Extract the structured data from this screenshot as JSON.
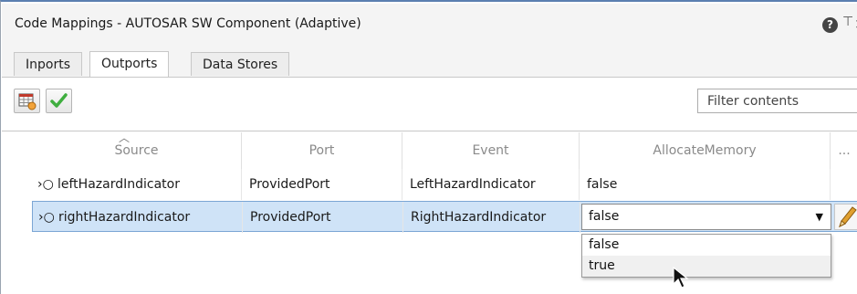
{
  "window": {
    "title": "Code Mappings - AUTOSAR SW Component (Adaptive)",
    "help_glyph": "?",
    "pin_glyph": "⊤",
    "close_glyph": "×"
  },
  "tabs": [
    {
      "label": "Inports",
      "active": false
    },
    {
      "label": "Outports",
      "active": true
    },
    {
      "label": "Data Stores",
      "active": false
    }
  ],
  "toolbar": {
    "buttons": [
      {
        "icon": "configure-table-icon"
      },
      {
        "icon": "validate-checkmark-icon"
      }
    ],
    "filter_placeholder": "Filter contents"
  },
  "table": {
    "columns": [
      "Source",
      "Port",
      "Event",
      "AllocateMemory",
      "..."
    ],
    "sorted_column": "Source",
    "rows": [
      {
        "source": "leftHazardIndicator",
        "port": "ProvidedPort",
        "event": "LeftHazardIndicator",
        "allocate_memory": "false",
        "selected": false
      },
      {
        "source": "rightHazardIndicator",
        "port": "ProvidedPort",
        "event": "RightHazardIndicator",
        "allocate_memory": "false",
        "selected": true
      }
    ]
  },
  "dropdown": {
    "current_value": "false",
    "options": [
      "false",
      "true"
    ],
    "hovered_option": "true"
  },
  "colors": {
    "selected_row": "#cfe3f7",
    "selected_row_border": "#7ba6d4",
    "checkmark_green": "#3fae3f",
    "pencil_orange": "#e0a030"
  }
}
